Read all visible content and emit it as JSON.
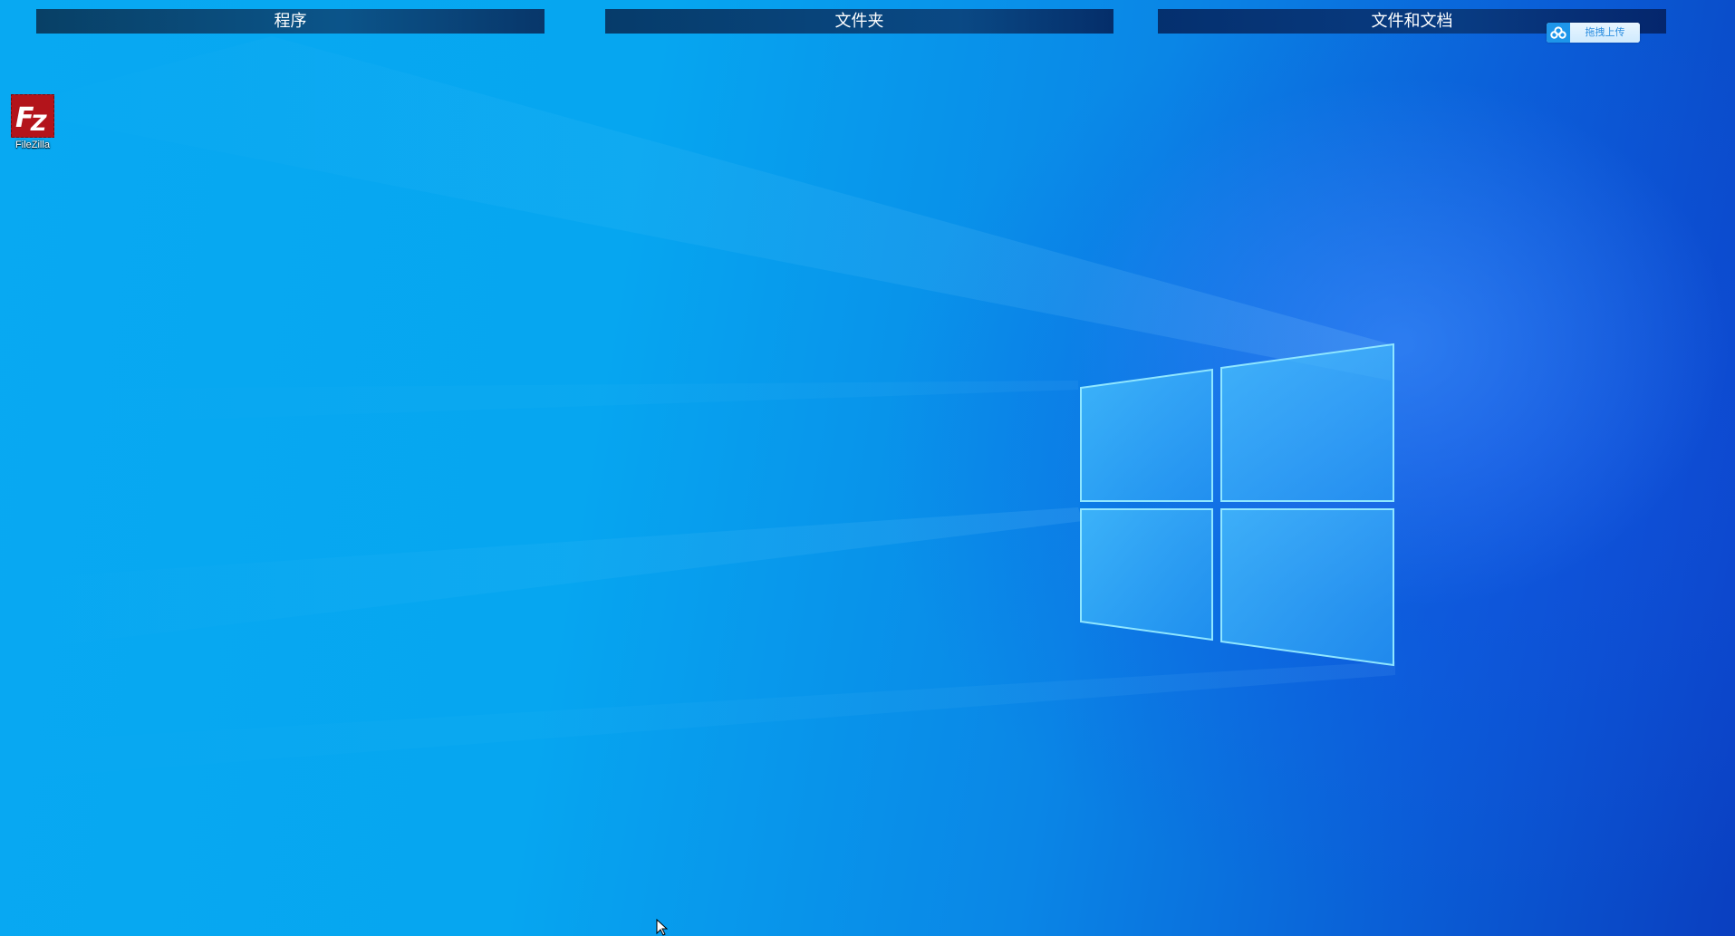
{
  "desktop": {
    "fences": [
      {
        "title": "程序"
      },
      {
        "title": "文件夹"
      },
      {
        "title": "文件和文档"
      }
    ],
    "upload_widget": {
      "label": "拖拽上传",
      "icon": "cloud-icon"
    },
    "icons": [
      {
        "label": "FileZilla",
        "icon": "filezilla-icon"
      }
    ]
  },
  "colors": {
    "fence_header_text": "#ffffff",
    "upload_accent": "#1e96ea",
    "filezilla_red": "#b3141b"
  }
}
